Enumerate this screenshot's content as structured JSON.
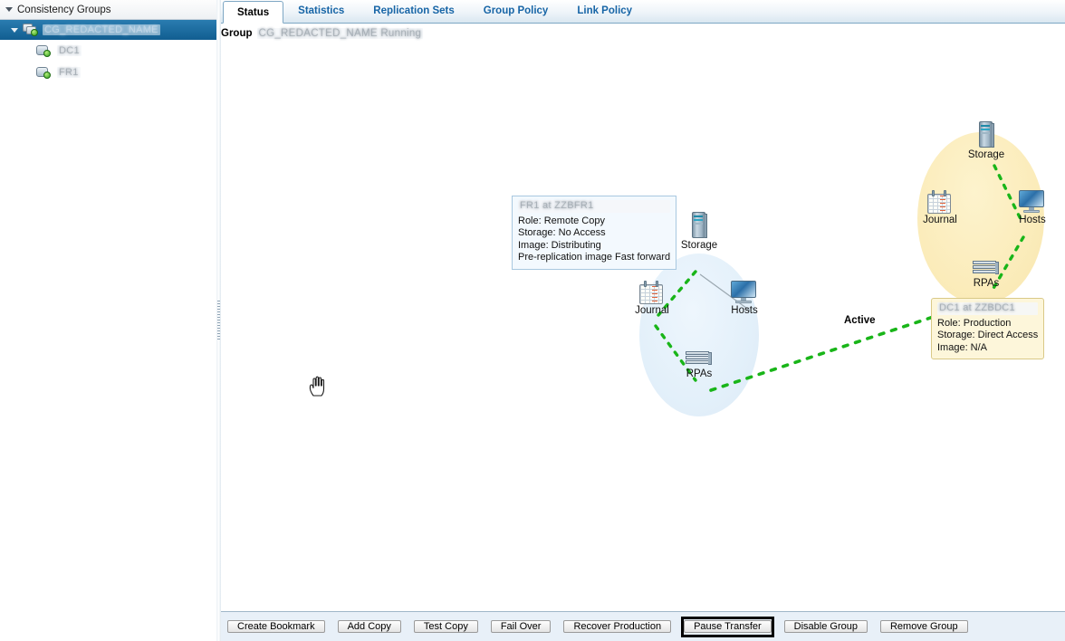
{
  "sidebar": {
    "header": "Consistency Groups",
    "root": {
      "label": "CG_REDACTED_NAME",
      "redacted": true,
      "icon": "group-icon"
    },
    "children": [
      {
        "label": "DC1",
        "redacted": true,
        "icon": "copy-icon"
      },
      {
        "label": "FR1",
        "redacted": true,
        "icon": "copy-icon"
      }
    ]
  },
  "tabs": [
    {
      "label": "Status",
      "active": true
    },
    {
      "label": "Statistics",
      "active": false
    },
    {
      "label": "Replication Sets",
      "active": false
    },
    {
      "label": "Group Policy",
      "active": false
    },
    {
      "label": "Link Policy",
      "active": false
    }
  ],
  "group_bar": {
    "label": "Group",
    "value": "CG_REDACTED_NAME Running"
  },
  "diagram": {
    "link_status": "Active",
    "clusters": [
      {
        "id": "left",
        "color": "#e3f0fa",
        "nodes": [
          {
            "name": "Storage",
            "icon": "storage-icon"
          },
          {
            "name": "Journal",
            "icon": "journal-icon"
          },
          {
            "name": "Hosts",
            "icon": "hosts-icon"
          },
          {
            "name": "RPAs",
            "icon": "rpas-icon"
          }
        ]
      },
      {
        "id": "right",
        "color": "#fbecbb",
        "nodes": [
          {
            "name": "Storage",
            "icon": "storage-icon"
          },
          {
            "name": "Journal",
            "icon": "journal-icon"
          },
          {
            "name": "Hosts",
            "icon": "hosts-icon"
          },
          {
            "name": "RPAs",
            "icon": "rpas-icon"
          }
        ]
      }
    ],
    "tooltips": [
      {
        "id": "left",
        "title": "FR1 at ZZBFR1",
        "title_redacted": true,
        "lines": [
          "Role: Remote Copy",
          "Storage: No Access",
          "Image: Distributing",
          "Pre-replication image Fast forward"
        ]
      },
      {
        "id": "right",
        "title": "DC1 at ZZBDC1",
        "title_redacted": true,
        "lines": [
          "Role: Production",
          "Storage: Direct Access",
          "Image: N/A"
        ]
      }
    ]
  },
  "buttons": [
    {
      "label": "Create Bookmark",
      "focused": false
    },
    {
      "label": "Add Copy",
      "focused": false
    },
    {
      "label": "Test Copy",
      "focused": false
    },
    {
      "label": "Fail Over",
      "focused": false
    },
    {
      "label": "Recover Production",
      "focused": false
    },
    {
      "label": "Pause Transfer",
      "focused": true
    },
    {
      "label": "Disable Group",
      "focused": false
    },
    {
      "label": "Remove Group",
      "focused": false
    }
  ],
  "cursor": {
    "type": "grab-hand-cursor"
  },
  "colors": {
    "accent": "#1765a6",
    "selection": "#1a6a9e",
    "link_green": "#19b519",
    "cluster_source": "#fbecbb",
    "cluster_target": "#e3f0fa"
  }
}
